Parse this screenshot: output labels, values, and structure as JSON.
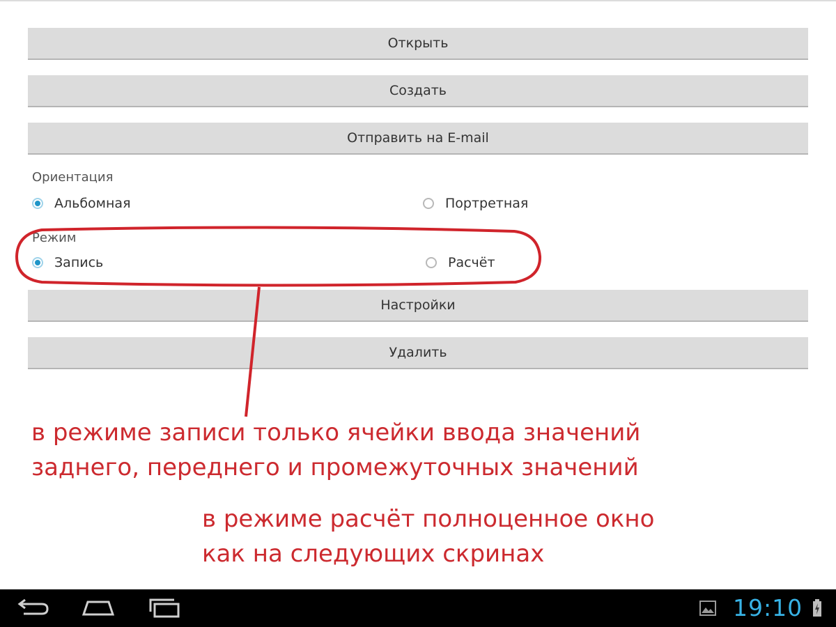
{
  "buttons": {
    "open": "Открыть",
    "create": "Создать",
    "send_email": "Отправить на E-mail",
    "settings": "Настройки",
    "delete": "Удалить"
  },
  "orientation": {
    "label": "Ориентация",
    "options": [
      {
        "label": "Альбомная",
        "checked": true
      },
      {
        "label": "Портретная",
        "checked": false
      }
    ]
  },
  "mode": {
    "label": "Режим",
    "options": [
      {
        "label": "Запись",
        "checked": true
      },
      {
        "label": "Расчёт",
        "checked": false
      }
    ]
  },
  "annotations": {
    "line1": "в режиме записи только ячейки ввода значений",
    "line2": "заднего, переднего и промежуточных значений",
    "line3": "в режиме расчёт полноценное окно",
    "line4": "как на следующих скринах"
  },
  "status_bar": {
    "time": "19:10",
    "icons": [
      "back-icon",
      "home-icon",
      "recent-apps-icon",
      "gallery-notification-icon",
      "battery-icon"
    ]
  },
  "colors": {
    "annotation_red": "#cc2a2f",
    "radio_checked": "#1f95c8",
    "clock_blue": "#38b2e5",
    "button_bg": "#dcdcdc"
  }
}
